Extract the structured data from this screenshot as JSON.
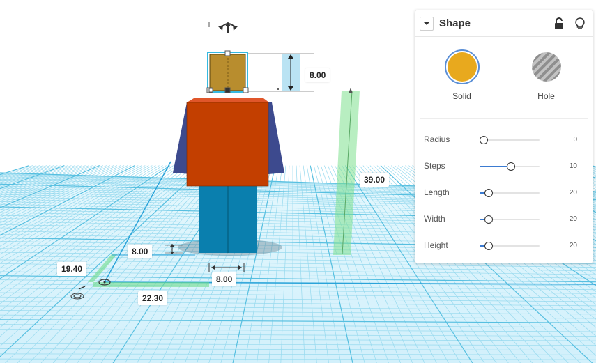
{
  "inspector": {
    "title": "Shape",
    "modes": [
      {
        "label": "Solid",
        "color": "#e8a91e",
        "active": true
      },
      {
        "label": "Hole",
        "color": "#9b9b9b",
        "active": false
      }
    ],
    "properties": [
      {
        "name": "Radius",
        "value": "0",
        "level": 0.0
      },
      {
        "name": "Steps",
        "value": "10",
        "level": 0.45
      },
      {
        "name": "Length",
        "value": "20",
        "level": 0.08
      },
      {
        "name": "Width",
        "value": "20",
        "level": 0.08
      },
      {
        "name": "Height",
        "value": "20",
        "level": 0.08
      }
    ]
  },
  "dimensions": {
    "head_height": "8.00",
    "total_height": "39.00",
    "foot_depth": "8.00",
    "foot_width": "8.00",
    "offset_y": "19.40",
    "offset_x": "22.30"
  },
  "colors": {
    "grid_line": "#8fd6ec",
    "grid_bg": "#cdeefa",
    "body": "#c33f00",
    "arms": "#3d4a8e",
    "legs": "#0a7fae",
    "head": "#b88d2e",
    "accent": "#3b7bd1"
  }
}
